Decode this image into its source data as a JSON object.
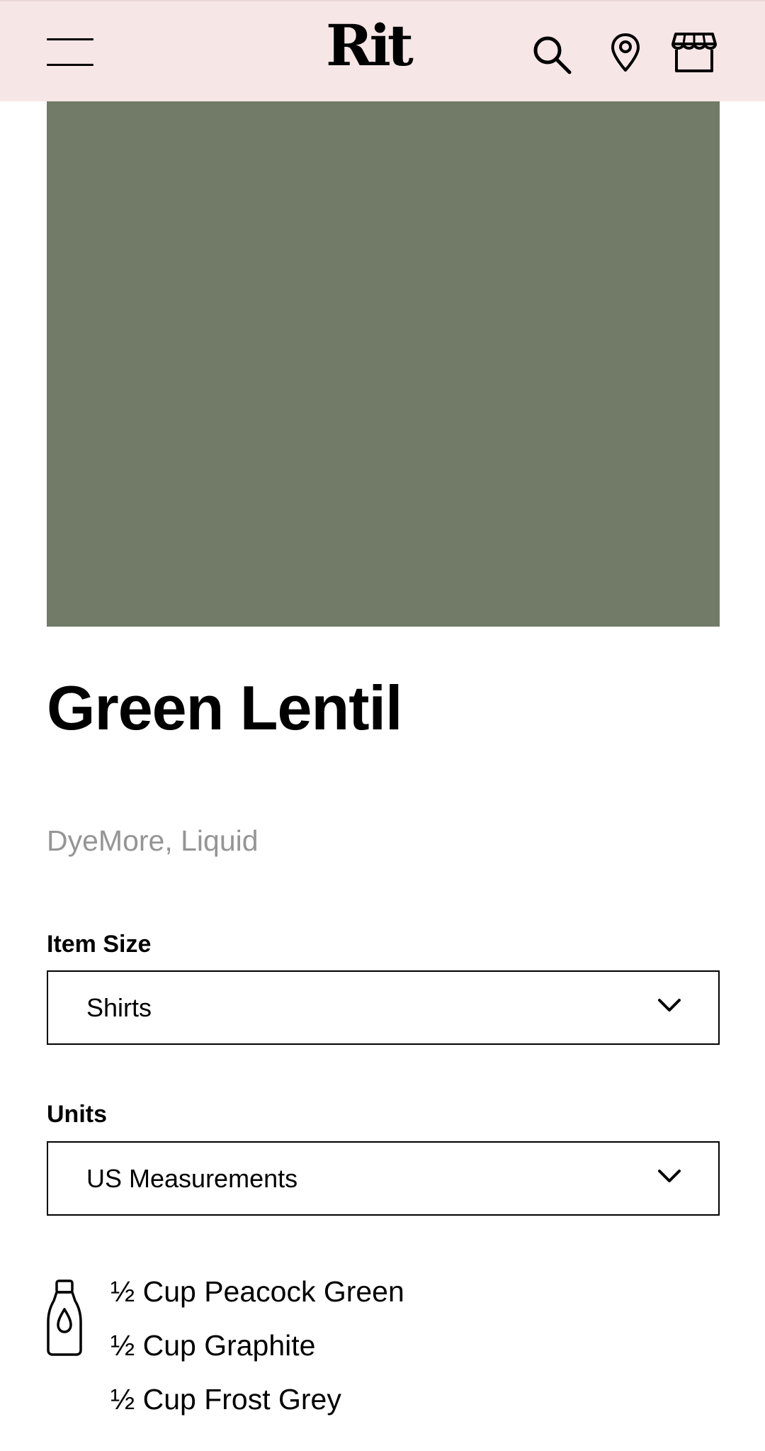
{
  "header": {
    "brand_logo": "Rit",
    "icons": {
      "menu": "hamburger-menu-icon",
      "search": "search-icon",
      "location": "map-pin-icon",
      "store": "storefront-icon"
    },
    "background_color": "#f7e6e6"
  },
  "product": {
    "swatch_color": "#717b67",
    "title": "Green Lentil",
    "subtitle": "DyeMore, Liquid"
  },
  "options": {
    "item_size": {
      "label": "Item Size",
      "selected": "Shirts"
    },
    "units": {
      "label": "Units",
      "selected": "US Measurements"
    }
  },
  "recipe": {
    "icon": "dye-bottle-icon",
    "lines": [
      "½ Cup Peacock Green",
      "½ Cup Graphite",
      "½ Cup Frost Grey"
    ]
  }
}
